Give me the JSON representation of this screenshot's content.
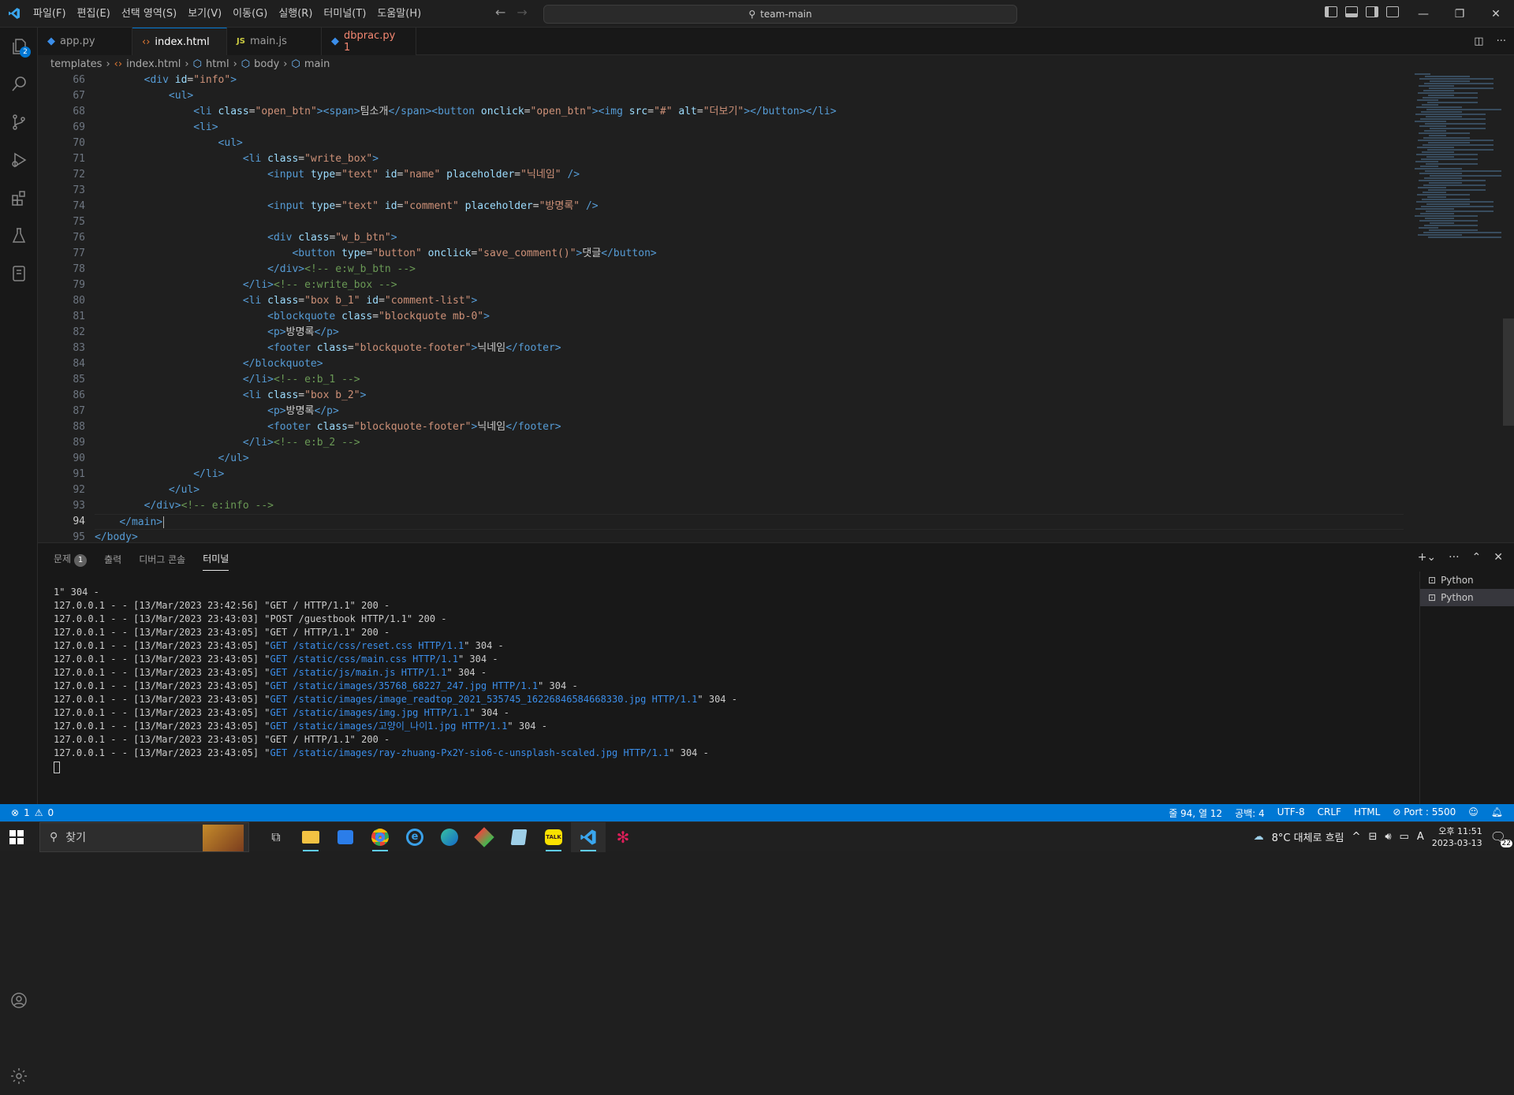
{
  "menubar": {
    "items": [
      "파일(F)",
      "편집(E)",
      "선택 영역(S)",
      "보기(V)",
      "이동(G)",
      "실행(R)",
      "터미널(T)",
      "도움말(H)"
    ],
    "search": "team-main"
  },
  "activity_badge": "2",
  "tabs": [
    {
      "label": "app.py",
      "icon": "python-icon",
      "active": false,
      "modified": false
    },
    {
      "label": "index.html",
      "icon": "html-icon",
      "active": true,
      "modified": true
    },
    {
      "label": "main.js",
      "icon": "js-icon",
      "active": false,
      "modified": false
    },
    {
      "label": "dbprac.py 1",
      "icon": "python-icon",
      "active": false,
      "modified": true
    }
  ],
  "breadcrumb": [
    "templates",
    "index.html",
    "html",
    "body",
    "main"
  ],
  "editor": {
    "current_line": 94,
    "lines": [
      {
        "n": 66,
        "i": 2,
        "h": "<span class=t>&lt;div</span> <span class=a>id</span>=<span class=s>\"info\"</span><span class=t>&gt;</span>"
      },
      {
        "n": 67,
        "i": 3,
        "h": "<span class=t>&lt;ul&gt;</span>"
      },
      {
        "n": 68,
        "i": 4,
        "h": "<span class=t>&lt;li</span> <span class=a>class</span>=<span class=s>\"open_btn\"</span><span class=t>&gt;&lt;span&gt;</span>팀소개<span class=t>&lt;/span&gt;&lt;button</span> <span class=a>onclick</span>=<span class=s>\"open_btn\"</span><span class=t>&gt;&lt;img</span> <span class=a>src</span>=<span class=s>\"#\"</span> <span class=a>alt</span>=<span class=s>\"더보기\"</span><span class=t>&gt;&lt;/button&gt;&lt;/li&gt;</span>"
      },
      {
        "n": 69,
        "i": 4,
        "h": "<span class=t>&lt;li&gt;</span>"
      },
      {
        "n": 70,
        "i": 5,
        "h": "<span class=t>&lt;ul&gt;</span>"
      },
      {
        "n": 71,
        "i": 6,
        "h": "<span class=t>&lt;li</span> <span class=a>class</span>=<span class=s>\"write_box\"</span><span class=t>&gt;</span>"
      },
      {
        "n": 72,
        "i": 7,
        "h": "<span class=t>&lt;input</span> <span class=a>type</span>=<span class=s>\"text\"</span> <span class=a>id</span>=<span class=s>\"name\"</span> <span class=a>placeholder</span>=<span class=s>\"닉네임\"</span> <span class=t>/&gt;</span>"
      },
      {
        "n": 73,
        "i": 0,
        "h": ""
      },
      {
        "n": 74,
        "i": 7,
        "h": "<span class=t>&lt;input</span> <span class=a>type</span>=<span class=s>\"text\"</span> <span class=a>id</span>=<span class=s>\"comment\"</span> <span class=a>placeholder</span>=<span class=s>\"방명록\"</span> <span class=t>/&gt;</span>"
      },
      {
        "n": 75,
        "i": 0,
        "h": ""
      },
      {
        "n": 76,
        "i": 7,
        "h": "<span class=t>&lt;div</span> <span class=a>class</span>=<span class=s>\"w_b_btn\"</span><span class=t>&gt;</span>"
      },
      {
        "n": 77,
        "i": 8,
        "h": "<span class=t>&lt;button</span> <span class=a>type</span>=<span class=s>\"button\"</span> <span class=a>onclick</span>=<span class=s>\"save_comment()\"</span><span class=t>&gt;</span>댓글<span class=t>&lt;/button&gt;</span>"
      },
      {
        "n": 78,
        "i": 7,
        "h": "<span class=t>&lt;/div&gt;</span><span class=c>&lt;!-- e:w_b_btn --&gt;</span>"
      },
      {
        "n": 79,
        "i": 6,
        "h": "<span class=t>&lt;/li&gt;</span><span class=c>&lt;!-- e:write_box --&gt;</span>"
      },
      {
        "n": 80,
        "i": 6,
        "h": "<span class=t>&lt;li</span> <span class=a>class</span>=<span class=s>\"box b_1\"</span> <span class=a>id</span>=<span class=s>\"comment-list\"</span><span class=t>&gt;</span>"
      },
      {
        "n": 81,
        "i": 7,
        "h": "<span class=t>&lt;blockquote</span> <span class=a>class</span>=<span class=s>\"blockquote mb-0\"</span><span class=t>&gt;</span>"
      },
      {
        "n": 82,
        "i": 7,
        "h": "<span class=t>&lt;p&gt;</span>방명록<span class=t>&lt;/p&gt;</span>"
      },
      {
        "n": 83,
        "i": 7,
        "h": "<span class=t>&lt;footer</span> <span class=a>class</span>=<span class=s>\"blockquote-footer\"</span><span class=t>&gt;</span>닉네임<span class=t>&lt;/footer&gt;</span>"
      },
      {
        "n": 84,
        "i": 6,
        "h": "<span class=t>&lt;/blockquote&gt;</span>"
      },
      {
        "n": 85,
        "i": 6,
        "h": "<span class=t>&lt;/li&gt;</span><span class=c>&lt;!-- e:b_1 --&gt;</span>"
      },
      {
        "n": 86,
        "i": 6,
        "h": "<span class=t>&lt;li</span> <span class=a>class</span>=<span class=s>\"box b_2\"</span><span class=t>&gt;</span>"
      },
      {
        "n": 87,
        "i": 7,
        "h": "<span class=t>&lt;p&gt;</span>방명록<span class=t>&lt;/p&gt;</span>"
      },
      {
        "n": 88,
        "i": 7,
        "h": "<span class=t>&lt;footer</span> <span class=a>class</span>=<span class=s>\"blockquote-footer\"</span><span class=t>&gt;</span>닉네임<span class=t>&lt;/footer&gt;</span>"
      },
      {
        "n": 89,
        "i": 6,
        "h": "<span class=t>&lt;/li&gt;</span><span class=c>&lt;!-- e:b_2 --&gt;</span>"
      },
      {
        "n": 90,
        "i": 5,
        "h": "<span class=t>&lt;/ul&gt;</span>"
      },
      {
        "n": 91,
        "i": 4,
        "h": "<span class=t>&lt;/li&gt;</span>"
      },
      {
        "n": 92,
        "i": 3,
        "h": "<span class=t>&lt;/ul&gt;</span>"
      },
      {
        "n": 93,
        "i": 2,
        "h": "<span class=t>&lt;/div&gt;</span><span class=c>&lt;!-- e:info --&gt;</span>"
      },
      {
        "n": 94,
        "i": 1,
        "h": "<span class=t>&lt;/main&gt;</span>"
      },
      {
        "n": 95,
        "i": 0,
        "h": "<span class=t>&lt;/body&gt;</span>"
      }
    ]
  },
  "panel": {
    "tabs": [
      "문제",
      "출력",
      "디버그 콘솔",
      "터미널"
    ],
    "problems_count": "1",
    "terminals": [
      "Python",
      "Python"
    ]
  },
  "terminal": [
    {
      "pre": "1\" 304 -",
      "blue": "",
      "post": ""
    },
    {
      "pre": "127.0.0.1 - - [13/Mar/2023 23:42:56] \"GET / HTTP/1.1\" 200 -",
      "blue": "",
      "post": ""
    },
    {
      "pre": "127.0.0.1 - - [13/Mar/2023 23:43:03] \"POST /guestbook HTTP/1.1\" 200 -",
      "blue": "",
      "post": ""
    },
    {
      "pre": "127.0.0.1 - - [13/Mar/2023 23:43:05] \"GET / HTTP/1.1\" 200 -",
      "blue": "",
      "post": ""
    },
    {
      "pre": "127.0.0.1 - - [13/Mar/2023 23:43:05] \"",
      "blue": "GET /static/css/reset.css HTTP/1.1",
      "post": "\" 304 -"
    },
    {
      "pre": "127.0.0.1 - - [13/Mar/2023 23:43:05] \"",
      "blue": "GET /static/css/main.css HTTP/1.1",
      "post": "\" 304 -"
    },
    {
      "pre": "127.0.0.1 - - [13/Mar/2023 23:43:05] \"",
      "blue": "GET /static/js/main.js HTTP/1.1",
      "post": "\" 304 -"
    },
    {
      "pre": "127.0.0.1 - - [13/Mar/2023 23:43:05] \"",
      "blue": "GET /static/images/35768_68227_247.jpg HTTP/1.1",
      "post": "\" 304 -"
    },
    {
      "pre": "127.0.0.1 - - [13/Mar/2023 23:43:05] \"",
      "blue": "GET /static/images/image_readtop_2021_535745_16226846584668330.jpg HTTP/1.1",
      "post": "\" 304 -"
    },
    {
      "pre": "127.0.0.1 - - [13/Mar/2023 23:43:05] \"",
      "blue": "GET /static/images/img.jpg HTTP/1.1",
      "post": "\" 304 -"
    },
    {
      "pre": "127.0.0.1 - - [13/Mar/2023 23:43:05] \"",
      "blue": "GET /static/images/고양이_나이1.jpg HTTP/1.1",
      "post": "\" 304 -"
    },
    {
      "pre": "127.0.0.1 - - [13/Mar/2023 23:43:05] \"GET / HTTP/1.1\" 200 -",
      "blue": "",
      "post": ""
    },
    {
      "pre": "127.0.0.1 - - [13/Mar/2023 23:43:05] \"",
      "blue": "GET /static/images/ray-zhuang-Px2Y-sio6-c-unsplash-scaled.jpg HTTP/1.1",
      "post": "\" 304 -"
    }
  ],
  "statusbar": {
    "errors": "1",
    "warnings": "0",
    "right": [
      "줄 94, 열 12",
      "공백: 4",
      "UTF-8",
      "CRLF",
      "HTML",
      "Port : 5500"
    ]
  },
  "taskbar": {
    "search": "찾기",
    "weather": "8°C  대체로 흐림",
    "lang": "A",
    "time": "오후 11:51",
    "date": "2023-03-13",
    "notif": "22"
  },
  "colors": {
    "accent": "#0078d4",
    "statusbar": "#0078d4"
  }
}
